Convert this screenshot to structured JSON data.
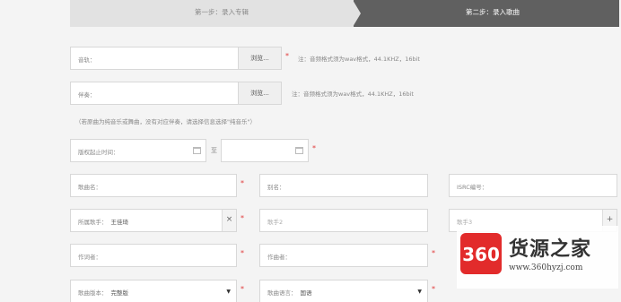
{
  "steps": {
    "step1": "第一步：录入专辑",
    "step2": "第二步：录入歌曲"
  },
  "audio": {
    "label": "音轨：",
    "browse": "浏览...",
    "required": "*",
    "note": "注：音频格式须为wav格式，44.1KHZ，16bit"
  },
  "accompaniment": {
    "label": "伴奏：",
    "browse": "浏览...",
    "note": "注：音频格式须为wav格式，44.1KHZ，16bit"
  },
  "hint": "（若原曲为纯音乐或舞曲，没有对应伴奏，请选择信息选择\"纯音乐\"）",
  "copyright": {
    "label": "版权起止时间：",
    "separator": "至",
    "required": "*"
  },
  "song_name": {
    "label": "歌曲名：",
    "required": "*"
  },
  "alias": {
    "label": "别名："
  },
  "isrc": {
    "label": "ISRC编号："
  },
  "singer1": {
    "label": "所属歌手：",
    "value": "王佳琦",
    "clear": "×",
    "required": "*"
  },
  "singer2": {
    "placeholder": "歌手2"
  },
  "singer3": {
    "placeholder": "歌手3",
    "add": "+"
  },
  "lyricist": {
    "label": "作词者：",
    "required": "*"
  },
  "composer": {
    "label": "作曲者：",
    "required": "*"
  },
  "version": {
    "label": "歌曲版本：",
    "value": "完整版",
    "caret": "▼",
    "required": "*"
  },
  "language": {
    "label": "歌曲语言：",
    "value": "国语",
    "caret": "▼",
    "required": "*"
  },
  "watermark": {
    "logo": "360",
    "title": "货源之家",
    "url": "www.360hyzj.com"
  }
}
